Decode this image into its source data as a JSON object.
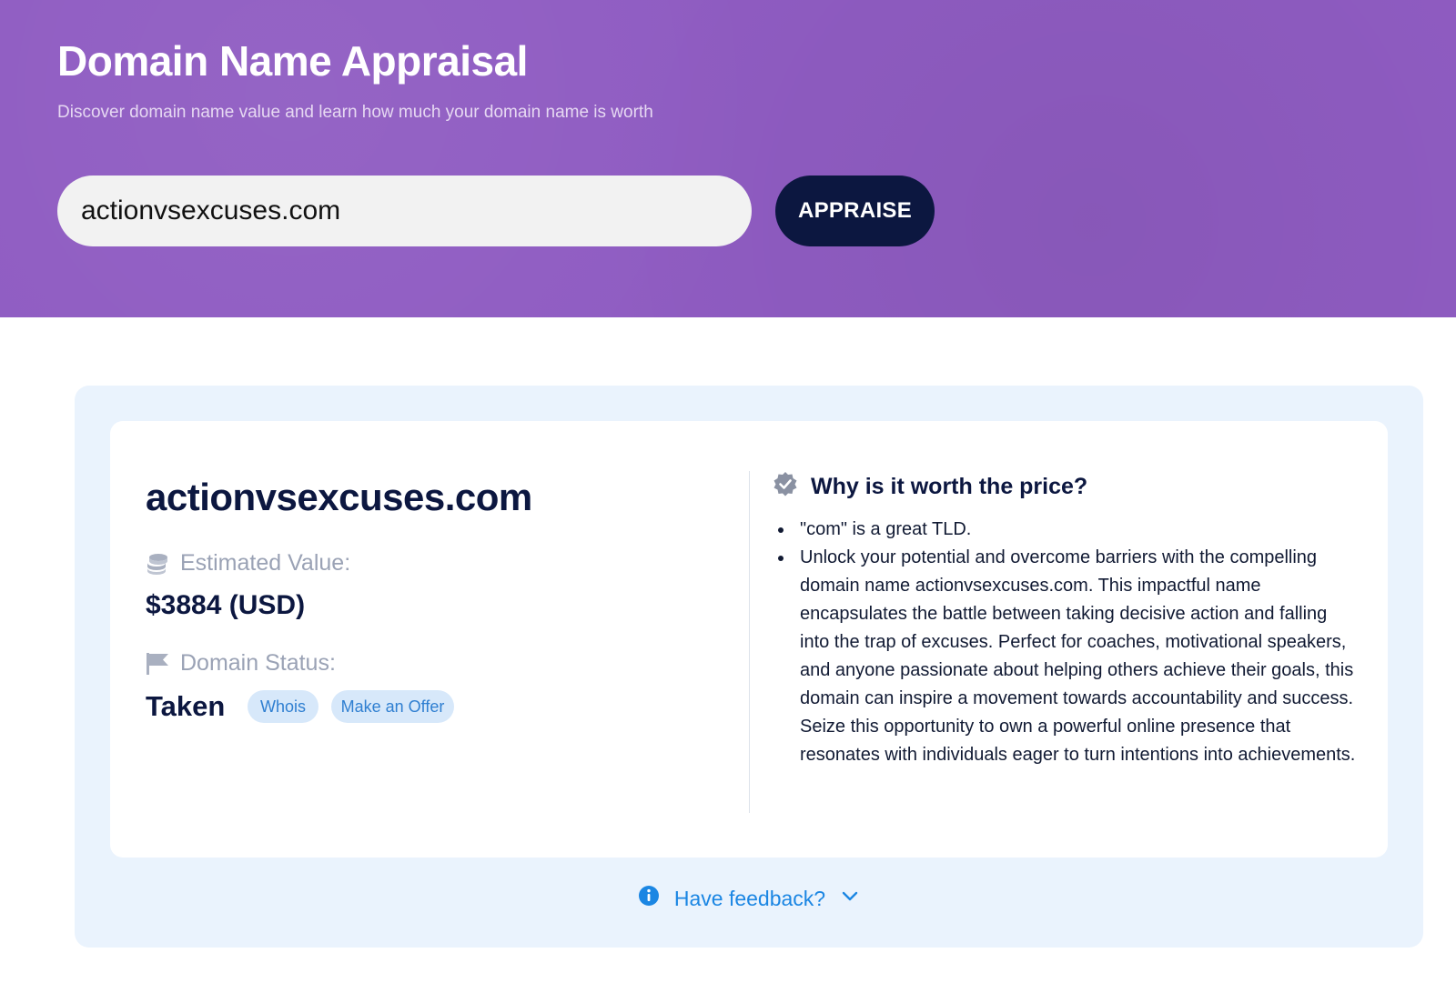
{
  "hero": {
    "title": "Domain Name Appraisal",
    "subtitle": "Discover domain name value and learn how much your domain name is worth",
    "search_value": "actionvsexcuses.com",
    "appraise_label": "APPRAISE"
  },
  "result": {
    "domain": "actionvsexcuses.com",
    "estimated_label": "Estimated Value:",
    "estimated_value": "$3884 (USD)",
    "status_label": "Domain Status:",
    "status_value": "Taken",
    "whois_label": "Whois",
    "offer_label": "Make an Offer",
    "why_heading": "Why is it worth the price?",
    "reasons": [
      "\"com\" is a great TLD.",
      "Unlock your potential and overcome barriers with the compelling domain name actionvsexcuses.com. This impactful name encapsulates the battle between taking decisive action and falling into the trap of excuses. Perfect for coaches, motivational speakers, and anyone passionate about helping others achieve their goals, this domain can inspire a movement towards accountability and success. Seize this opportunity to own a powerful online presence that resonates with individuals eager to turn intentions into achievements."
    ]
  },
  "feedback": {
    "label": "Have feedback?"
  },
  "icons": {
    "estimated": "coins-icon",
    "status": "flag-icon",
    "why": "verified-badge-icon",
    "feedback": "info-icon",
    "feedback_toggle": "chevron-down-icon"
  },
  "colors": {
    "hero_bg": "#8f5cc2",
    "button_bg": "#0c1740",
    "panel_bg": "#eaf3fd",
    "pill_bg": "#d7e8fa",
    "link": "#1b86e3"
  }
}
